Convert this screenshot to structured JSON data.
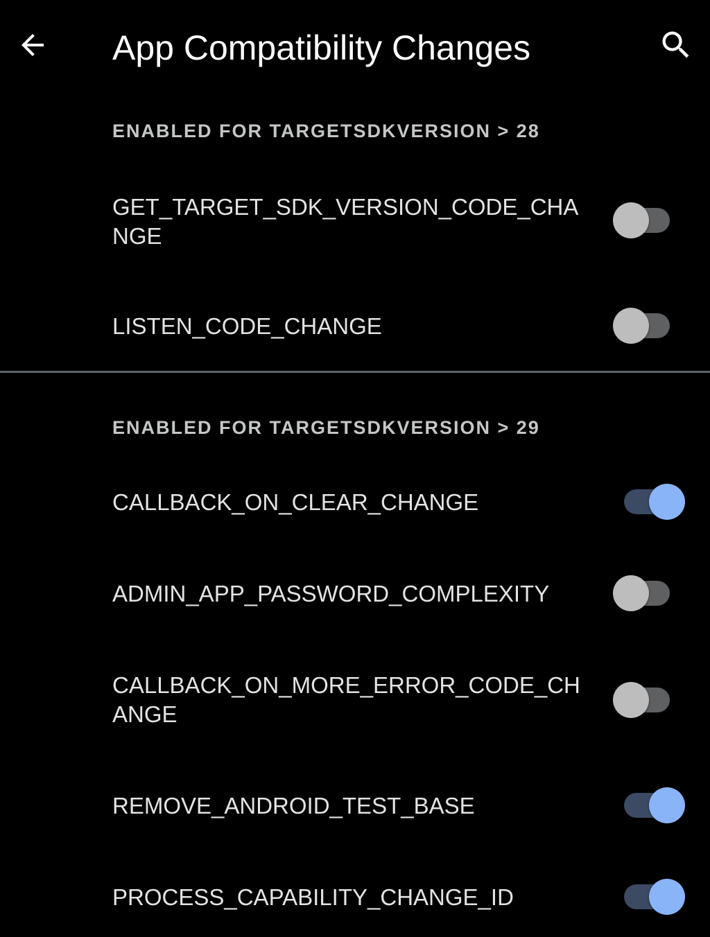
{
  "toolbar": {
    "title": "App Compatibility Changes",
    "back_icon": "arrow-back-icon",
    "search_icon": "search-icon"
  },
  "colors": {
    "background": "#000000",
    "accent": "#8ab4f8",
    "switch_off_thumb": "#bdbdbd",
    "divider": "#5f6368"
  },
  "sections": [
    {
      "header": "ENABLED FOR TARGETSDKVERSION > 28",
      "items": [
        {
          "label": "GET_TARGET_SDK_VERSION_CODE_CHANGE",
          "enabled": false
        },
        {
          "label": "LISTEN_CODE_CHANGE",
          "enabled": false
        }
      ]
    },
    {
      "header": "ENABLED FOR TARGETSDKVERSION > 29",
      "items": [
        {
          "label": "CALLBACK_ON_CLEAR_CHANGE",
          "enabled": true
        },
        {
          "label": "ADMIN_APP_PASSWORD_COMPLEXITY",
          "enabled": false
        },
        {
          "label": "CALLBACK_ON_MORE_ERROR_CODE_CHANGE",
          "enabled": false
        },
        {
          "label": "REMOVE_ANDROID_TEST_BASE",
          "enabled": true
        },
        {
          "label": "PROCESS_CAPABILITY_CHANGE_ID",
          "enabled": true
        }
      ]
    }
  ]
}
